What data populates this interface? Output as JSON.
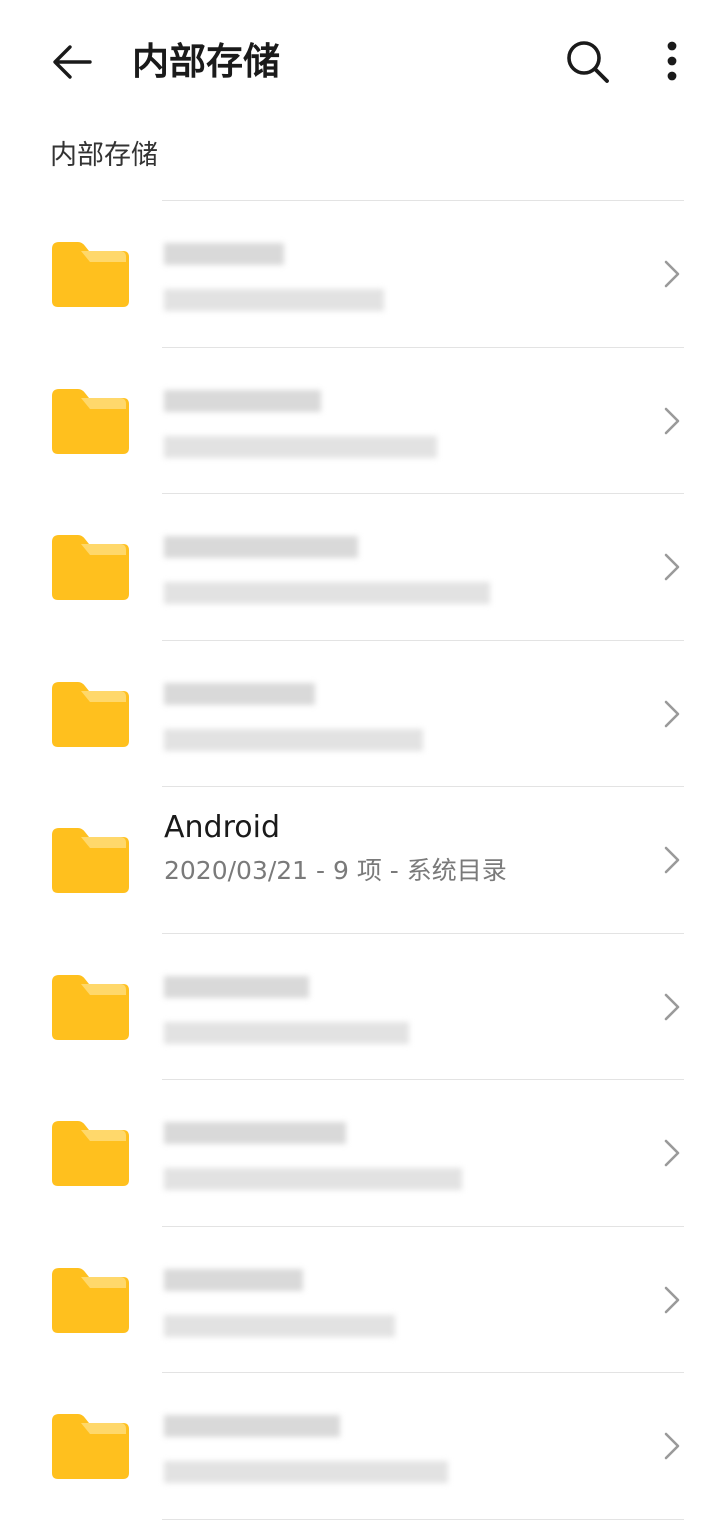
{
  "header": {
    "title": "内部存储",
    "back_icon": "arrow-left-icon",
    "search_icon": "search-icon",
    "more_icon": "more-vertical-icon"
  },
  "breadcrumb": "内部存储",
  "colors": {
    "folder": "#FFC01E",
    "folder_tab": "#FFD86B",
    "divider": "#E3E3E3",
    "secondary_text": "#7A7A7A"
  },
  "files": [
    {
      "name": "",
      "meta": "",
      "blurred": true
    },
    {
      "name": "",
      "meta": "",
      "blurred": true
    },
    {
      "name": "",
      "meta": "",
      "blurred": true
    },
    {
      "name": "",
      "meta": "",
      "blurred": true
    },
    {
      "name": "Android",
      "meta": "2020/03/21 - 9 项 - 系统目录",
      "blurred": false
    },
    {
      "name": "",
      "meta": "",
      "blurred": true
    },
    {
      "name": "",
      "meta": "",
      "blurred": true
    },
    {
      "name": "",
      "meta": "",
      "blurred": true
    },
    {
      "name": "",
      "meta": "",
      "blurred": true
    }
  ]
}
